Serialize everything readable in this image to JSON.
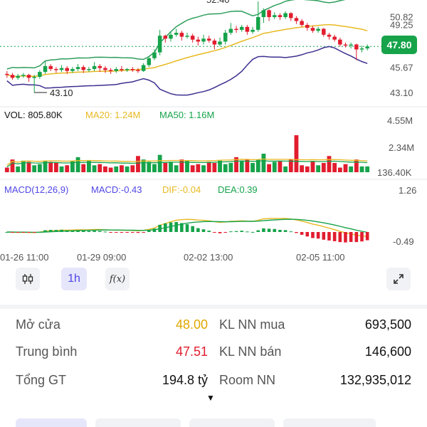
{
  "price_axis": {
    "labels": [
      "52.40",
      "50.82",
      "49.25",
      "47.80",
      "45.67",
      "43.10"
    ],
    "current_price": "47.80",
    "low_marker": "43.10"
  },
  "volume": {
    "vol_label": "VOL: 805.80K",
    "ma20_label": "MA20: 1.24M",
    "ma50_label": "MA50: 1.16M",
    "axis": [
      "4.55M",
      "2.34M",
      "136.40K"
    ]
  },
  "macd": {
    "title": "MACD(12,26,9)",
    "macd_label": "MACD:-0.43",
    "dif_label": "DIF:-0.04",
    "dea_label": "DEA:0.39",
    "axis": [
      "1.26",
      "-0.49"
    ]
  },
  "time_axis": [
    "01-26 11:00",
    "01-29 09:00",
    "02-02 13:00",
    "02-05 11:00"
  ],
  "toolbar": {
    "candle_icon": "candlestick-icon",
    "interval_label": "1h",
    "indicator_label": "f(x)",
    "expand_icon": "expand-icon"
  },
  "stats": {
    "open_label": "Mở cửa",
    "open_value": "48.00",
    "avg_label": "Trung bình",
    "avg_value": "47.51",
    "total_label": "Tổng GT",
    "total_value": "194.8 tỷ",
    "foreign_buy_label": "KL NN mua",
    "foreign_buy_value": "693,500",
    "foreign_sell_label": "KL NN bán",
    "foreign_sell_value": "146,600",
    "room_label": "Room NN",
    "room_value": "132,935,012"
  },
  "colors": {
    "up": "#16a34a",
    "down": "#e11d2e",
    "ma_yellow": "#e8b923",
    "dif_line": "#e8b923",
    "dea_line": "#16a34a",
    "bands": "#3b2f8f",
    "accent": "#4f46e5",
    "open_color": "#e0a800",
    "avg_color": "#e11d2e"
  },
  "chart_data": {
    "type": "candlestick",
    "interval": "1h",
    "price_ylim": [
      43.1,
      52.4
    ],
    "candles": [
      [
        45.0,
        44.9,
        45.3,
        44.6
      ],
      [
        44.9,
        44.6,
        45.1,
        44.4
      ],
      [
        44.6,
        44.8,
        45.0,
        44.4
      ],
      [
        44.8,
        44.9,
        45.1,
        44.6
      ],
      [
        44.9,
        44.6,
        45.0,
        44.2
      ],
      [
        44.6,
        44.7,
        44.9,
        43.1
      ],
      [
        44.7,
        45.2,
        45.4,
        44.5
      ],
      [
        45.2,
        45.8,
        46.3,
        45.0
      ],
      [
        45.8,
        45.5,
        46.0,
        45.3
      ],
      [
        45.5,
        45.4,
        45.7,
        45.1
      ],
      [
        45.4,
        45.6,
        45.9,
        45.2
      ],
      [
        45.6,
        45.3,
        45.8,
        45.0
      ],
      [
        45.3,
        45.5,
        45.7,
        45.1
      ],
      [
        45.5,
        45.7,
        46.0,
        45.3
      ],
      [
        45.7,
        45.4,
        45.9,
        45.1
      ],
      [
        45.4,
        45.5,
        45.7,
        45.2
      ],
      [
        45.5,
        45.8,
        46.2,
        45.3
      ],
      [
        45.8,
        45.6,
        46.0,
        45.2
      ],
      [
        45.6,
        45.4,
        45.8,
        45.1
      ],
      [
        45.4,
        45.3,
        45.6,
        45.0
      ],
      [
        45.3,
        45.5,
        45.7,
        45.1
      ],
      [
        45.5,
        45.4,
        45.8,
        45.2
      ],
      [
        45.4,
        45.5,
        45.6,
        45.2
      ],
      [
        45.5,
        45.4,
        45.7,
        45.2
      ],
      [
        45.4,
        45.3,
        45.6,
        45.1
      ],
      [
        45.3,
        45.9,
        46.1,
        45.2
      ],
      [
        45.9,
        46.6,
        46.8,
        45.7
      ],
      [
        46.6,
        47.2,
        47.5,
        46.4
      ],
      [
        47.2,
        48.9,
        49.5,
        46.9
      ],
      [
        48.9,
        48.6,
        49.0,
        48.2
      ],
      [
        48.6,
        49.0,
        49.3,
        48.3
      ],
      [
        49.0,
        49.2,
        49.6,
        48.8
      ],
      [
        49.2,
        48.8,
        49.4,
        48.4
      ],
      [
        48.8,
        48.9,
        49.2,
        48.6
      ],
      [
        48.9,
        48.5,
        49.1,
        48.2
      ],
      [
        48.5,
        48.3,
        48.8,
        47.9
      ],
      [
        48.3,
        48.6,
        49.0,
        48.0
      ],
      [
        48.6,
        48.4,
        48.9,
        48.2
      ],
      [
        48.4,
        48.0,
        48.6,
        47.5
      ],
      [
        48.0,
        48.3,
        48.7,
        47.8
      ],
      [
        48.3,
        49.2,
        49.5,
        48.0
      ],
      [
        49.2,
        49.6,
        50.2,
        49.0
      ],
      [
        49.6,
        49.5,
        49.9,
        49.2
      ],
      [
        49.5,
        49.8,
        50.0,
        49.3
      ],
      [
        49.8,
        49.3,
        50.0,
        49.0
      ],
      [
        49.3,
        49.5,
        49.8,
        49.1
      ],
      [
        49.5,
        50.8,
        52.4,
        49.3
      ],
      [
        50.8,
        51.5,
        51.7,
        50.2
      ],
      [
        51.5,
        50.8,
        51.6,
        50.4
      ],
      [
        50.8,
        51.0,
        51.3,
        50.6
      ],
      [
        51.0,
        50.8,
        51.2,
        50.5
      ],
      [
        50.8,
        51.2,
        51.4,
        50.6
      ],
      [
        51.2,
        50.7,
        51.3,
        50.4
      ],
      [
        50.7,
        50.4,
        50.9,
        50.1
      ],
      [
        50.4,
        50.0,
        50.6,
        49.8
      ],
      [
        50.0,
        49.7,
        50.2,
        49.4
      ],
      [
        49.7,
        49.4,
        49.9,
        49.2
      ],
      [
        49.4,
        49.6,
        49.8,
        49.2
      ],
      [
        49.6,
        49.0,
        49.7,
        48.8
      ],
      [
        49.0,
        48.8,
        49.2,
        48.5
      ],
      [
        48.8,
        48.5,
        49.0,
        48.3
      ],
      [
        48.5,
        48.0,
        48.7,
        47.8
      ],
      [
        48.0,
        47.9,
        48.2,
        47.7
      ],
      [
        47.9,
        48.0,
        48.2,
        47.6
      ],
      [
        48.0,
        47.5,
        48.1,
        46.4
      ],
      [
        47.5,
        47.6,
        47.9,
        47.2
      ],
      [
        47.6,
        47.8,
        48.0,
        47.4
      ]
    ],
    "volume_ylim": [
      0,
      4.55
    ],
    "volume": [
      0.4,
      1.1,
      0.5,
      1.0,
      0.9,
      0.6,
      0.7,
      1.0,
      0.9,
      0.8,
      0.5,
      0.6,
      1.0,
      1.3,
      0.7,
      1.0,
      0.6,
      0.7,
      0.5,
      0.4,
      0.5,
      0.6,
      0.5,
      0.6,
      1.4,
      1.1,
      0.9,
      0.7,
      1.5,
      0.8,
      0.9,
      0.6,
      1.1,
      1.0,
      0.6,
      0.7,
      0.6,
      0.9,
      0.8,
      1.0,
      0.7,
      0.8,
      1.3,
      1.0,
      1.1,
      0.8,
      1.1,
      1.6,
      0.7,
      0.9,
      1.0,
      0.5,
      1.1,
      0.5,
      0.6,
      0.5,
      0.9,
      0.6,
      0.8,
      1.4,
      0.8,
      0.4,
      0.7,
      0.5,
      1.1,
      0.5,
      0.5
    ],
    "macd_ylim": [
      -0.49,
      1.26
    ]
  }
}
